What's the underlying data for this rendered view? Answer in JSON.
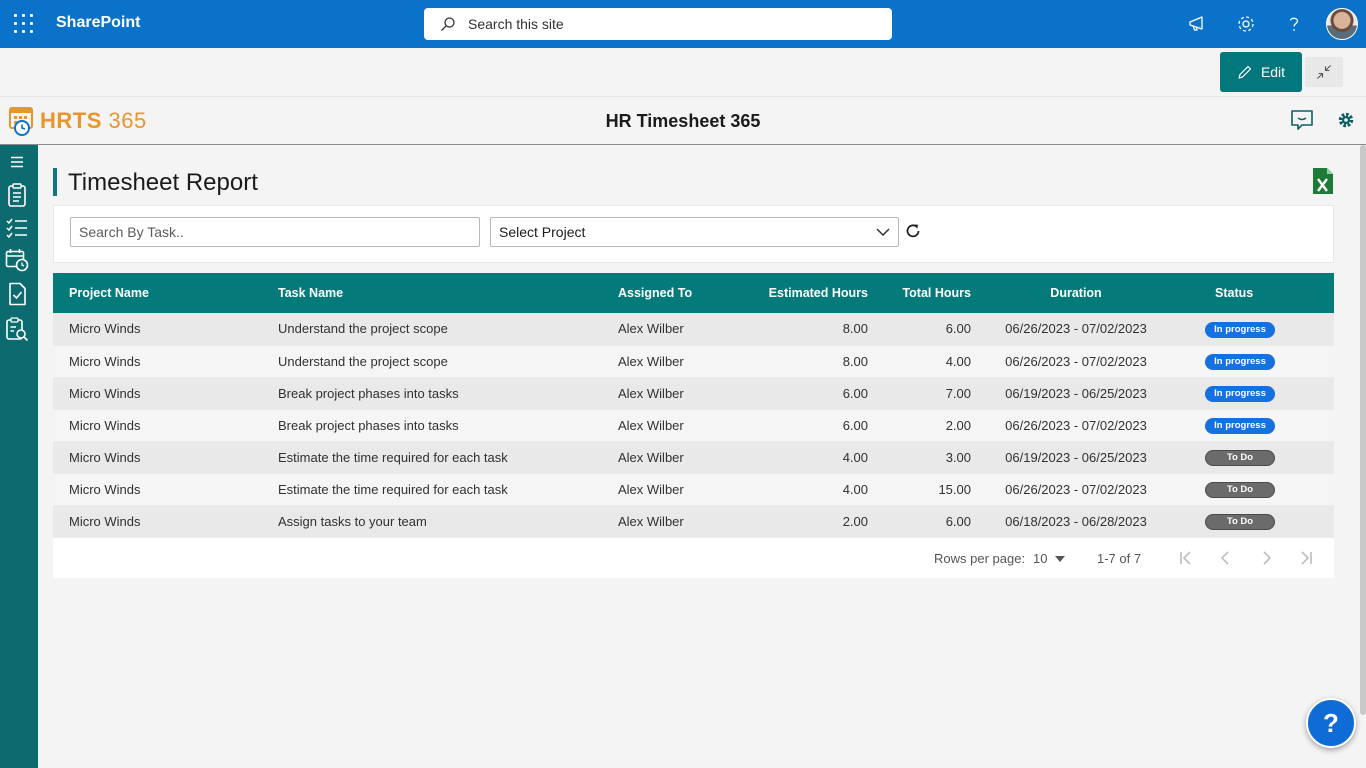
{
  "suitebar": {
    "brand": "SharePoint",
    "search_placeholder": "Search this site"
  },
  "commandbar": {
    "edit_label": "Edit"
  },
  "app": {
    "logo_text": "HRTS",
    "logo_number": "365",
    "title": "HR Timesheet 365"
  },
  "page": {
    "title": "Timesheet Report",
    "search_placeholder": "Search By Task..",
    "project_select": "Select Project"
  },
  "table": {
    "headers": {
      "project": "Project Name",
      "task": "Task Name",
      "assigned": "Assigned To",
      "estimated": "Estimated Hours",
      "total": "Total Hours",
      "duration": "Duration",
      "status": "Status"
    },
    "rows": [
      {
        "project": "Micro Winds",
        "task": "Understand the project scope",
        "assigned": "Alex Wilber",
        "estimated": "8.00",
        "total": "6.00",
        "duration": "06/26/2023 - 07/02/2023",
        "status": "In progress"
      },
      {
        "project": "Micro Winds",
        "task": "Understand the project scope",
        "assigned": "Alex Wilber",
        "estimated": "8.00",
        "total": "4.00",
        "duration": "06/26/2023 - 07/02/2023",
        "status": "In progress"
      },
      {
        "project": "Micro Winds",
        "task": "Break project phases into tasks",
        "assigned": "Alex Wilber",
        "estimated": "6.00",
        "total": "7.00",
        "duration": "06/19/2023 - 06/25/2023",
        "status": "In progress"
      },
      {
        "project": "Micro Winds",
        "task": "Break project phases into tasks",
        "assigned": "Alex Wilber",
        "estimated": "6.00",
        "total": "2.00",
        "duration": "06/26/2023 - 07/02/2023",
        "status": "In progress"
      },
      {
        "project": "Micro Winds",
        "task": "Estimate the time required for each task",
        "assigned": "Alex Wilber",
        "estimated": "4.00",
        "total": "3.00",
        "duration": "06/19/2023 - 06/25/2023",
        "status": "To Do"
      },
      {
        "project": "Micro Winds",
        "task": "Estimate the time required for each task",
        "assigned": "Alex Wilber",
        "estimated": "4.00",
        "total": "15.00",
        "duration": "06/26/2023 - 07/02/2023",
        "status": "To Do"
      },
      {
        "project": "Micro Winds",
        "task": "Assign tasks to your team",
        "assigned": "Alex Wilber",
        "estimated": "2.00",
        "total": "6.00",
        "duration": "06/18/2023 - 06/28/2023",
        "status": "To Do"
      }
    ]
  },
  "pager": {
    "rows_per_page_label": "Rows per page:",
    "rows_per_page": "10",
    "range": "1-7 of 7"
  },
  "help_label": "?",
  "colors": {
    "suitebar": "#0a72c9",
    "accent": "#03787c",
    "rail": "#0c6b6e",
    "in_progress": "#1670e0",
    "to_do": "#6b6b6b",
    "logo": "#e8962c"
  }
}
